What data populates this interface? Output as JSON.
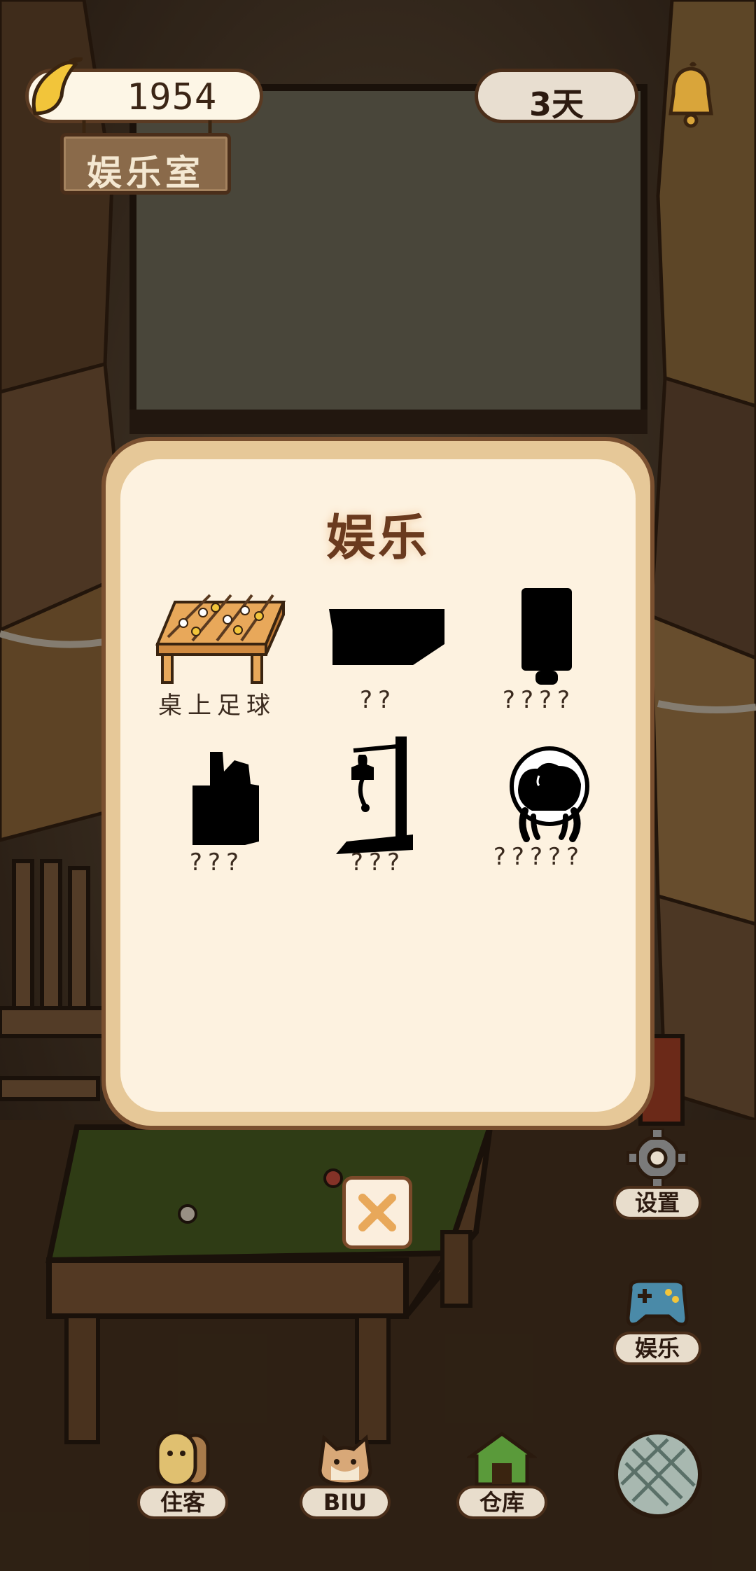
{
  "top_bar": {
    "banana_count": "1954",
    "room_name": "娱乐室",
    "days": "3天",
    "icons": [
      "banana-icon",
      "bell-icon"
    ]
  },
  "modal": {
    "title": "娱乐",
    "items": [
      {
        "label": "桌上足球",
        "icon": "foosball-table-icon",
        "unlocked": true
      },
      {
        "label": "??",
        "icon": "locked-item-silhouette-icon",
        "unlocked": false
      },
      {
        "label": "????",
        "icon": "locked-item-silhouette-icon",
        "unlocked": false
      },
      {
        "label": "???",
        "icon": "locked-item-silhouette-icon",
        "unlocked": false
      },
      {
        "label": "???",
        "icon": "locked-item-silhouette-icon",
        "unlocked": false
      },
      {
        "label": "?????",
        "icon": "locked-item-silhouette-icon",
        "unlocked": false
      }
    ],
    "close_icon": "close-icon"
  },
  "side_menu": {
    "settings_label": "设置",
    "entertainment_label": "娱乐"
  },
  "bottom_nav": {
    "residents_label": "住客",
    "biu_label": "BIU",
    "storage_label": "仓库"
  },
  "colors": {
    "panel_frame": "#e6c898",
    "panel_fill": "#fdf2e0",
    "outline": "#4a2e1a",
    "title": "#6a3a1e"
  }
}
